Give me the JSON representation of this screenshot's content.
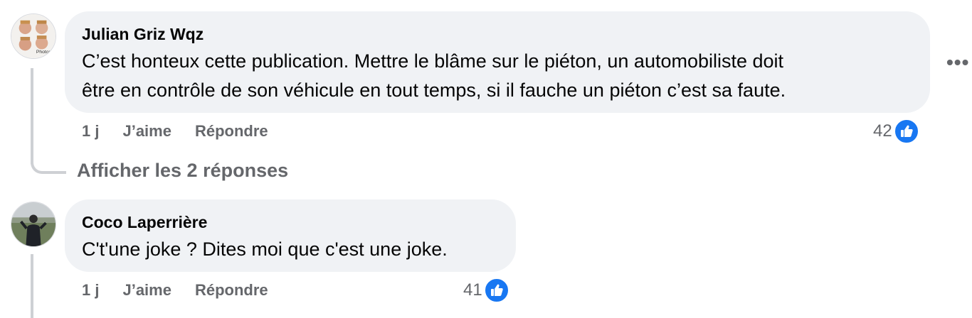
{
  "comments": [
    {
      "author": "Julian Griz Wqz",
      "text_lines": [
        "C’est honteux cette publication. Mettre le blâme sur le piéton, un automobiliste doit",
        "être en contrôle de son véhicule en tout temps, si il fauche un piéton c’est sa faute."
      ],
      "time": "1 j",
      "like_label": "J’aime",
      "reply_label": "Répondre",
      "reaction_count": "42",
      "reaction_icon": "thumbs-up-icon",
      "avatar_text": "Photom"
    },
    {
      "author": "Coco Laperrière",
      "text_lines": [
        "C't'une joke ? Dites moi que c'est une joke."
      ],
      "time": "1 j",
      "like_label": "J’aime",
      "reply_label": "Répondre",
      "reaction_count": "41",
      "reaction_icon": "thumbs-up-icon"
    }
  ],
  "view_replies_label": "Afficher les 2 réponses",
  "more_options_icon": "more-horizontal-icon",
  "colors": {
    "bubble": "#f0f2f5",
    "meta": "#65676b",
    "like_blue": "#1877f2",
    "thread": "#ced0d4"
  }
}
